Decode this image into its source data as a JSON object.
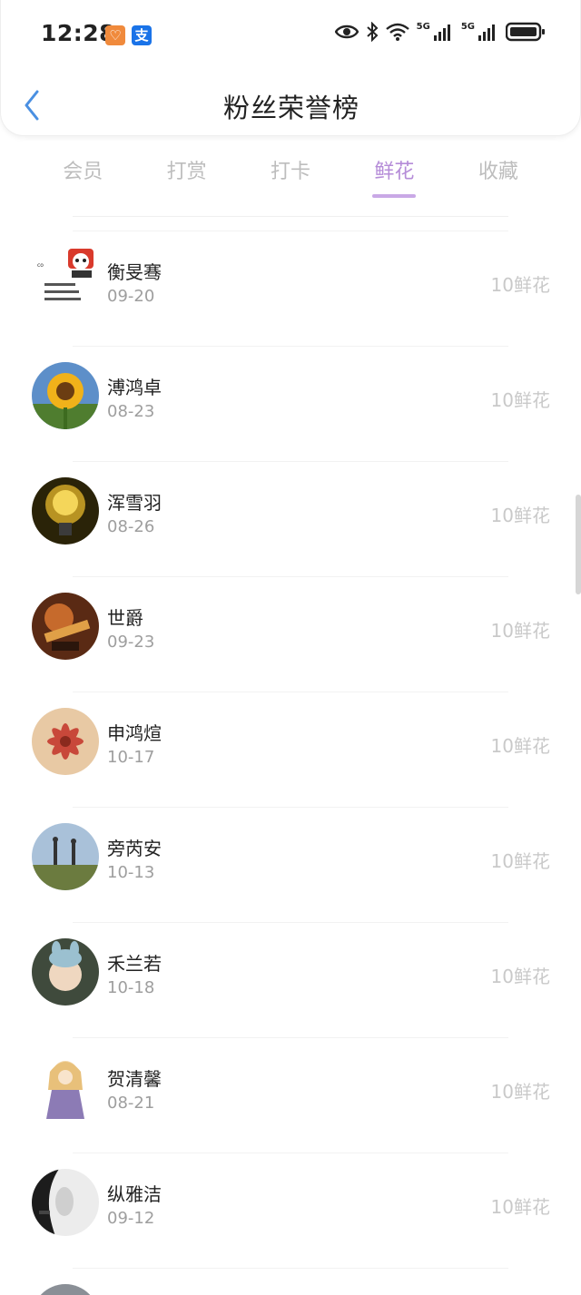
{
  "status_bar": {
    "time": "12:28",
    "app_badge_1": "♡",
    "app_badge_2": "支",
    "net_1": "5G",
    "net_2": "5G"
  },
  "header": {
    "title": "粉丝荣誉榜"
  },
  "tabs": [
    {
      "label": "会员",
      "active": false
    },
    {
      "label": "打赏",
      "active": false
    },
    {
      "label": "打卡",
      "active": false
    },
    {
      "label": "鲜花",
      "active": true
    },
    {
      "label": "收藏",
      "active": false
    }
  ],
  "colors": {
    "accent": "#b58cd8",
    "back_arrow": "#4a90e2"
  },
  "fans": [
    {
      "name": "衡旻骞",
      "date": "09-20",
      "count": "10鲜花",
      "avatar": "meme-sticker"
    },
    {
      "name": "溥鸿卓",
      "date": "08-23",
      "count": "10鲜花",
      "avatar": "sunflower"
    },
    {
      "name": "浑雪羽",
      "date": "08-26",
      "count": "10鲜花",
      "avatar": "light-bulb"
    },
    {
      "name": "世爵",
      "date": "09-23",
      "count": "10鲜花",
      "avatar": "game-hero"
    },
    {
      "name": "申鸿煊",
      "date": "10-17",
      "count": "10鲜花",
      "avatar": "red-flower"
    },
    {
      "name": "旁芮安",
      "date": "10-13",
      "count": "10鲜花",
      "avatar": "couple-field"
    },
    {
      "name": "禾兰若",
      "date": "10-18",
      "count": "10鲜花",
      "avatar": "child-hat"
    },
    {
      "name": "贺清馨",
      "date": "08-21",
      "count": "10鲜花",
      "avatar": "anime-girl"
    },
    {
      "name": "纵雅洁",
      "date": "09-12",
      "count": "10鲜花",
      "avatar": "bw-portrait"
    }
  ]
}
